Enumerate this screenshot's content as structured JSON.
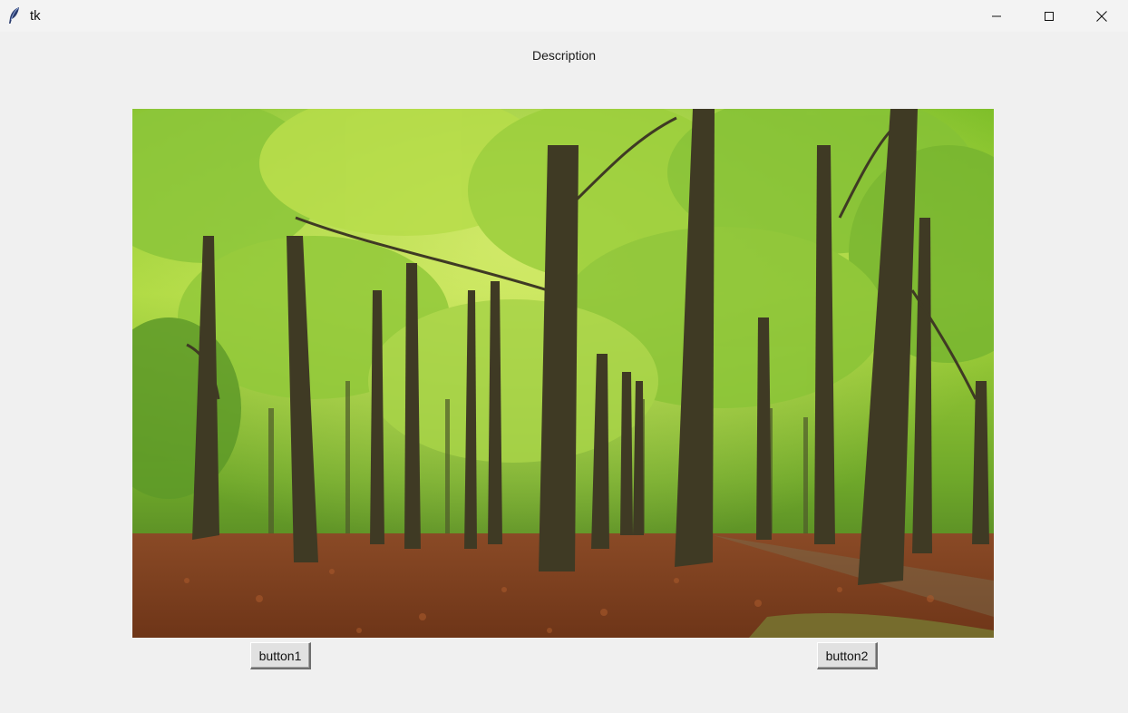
{
  "window": {
    "title": "tk",
    "controls": {
      "minimize_icon": "minimize-icon",
      "maximize_icon": "maximize-icon",
      "close_icon": "close-icon"
    }
  },
  "content": {
    "description": "Description",
    "image": {
      "subject": "beech forest with green canopy and autumn leaf floor"
    },
    "buttons": [
      {
        "label": "button1"
      },
      {
        "label": "button2"
      }
    ]
  },
  "colors": {
    "background": "#f0f0f0",
    "titlebar": "#f3f3f3",
    "button_face": "#e1e1e1"
  }
}
